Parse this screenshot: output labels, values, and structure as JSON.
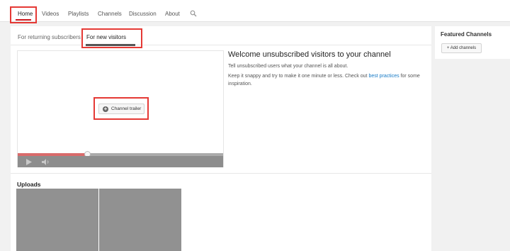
{
  "nav": {
    "tabs": [
      "Home",
      "Videos",
      "Playlists",
      "Channels",
      "Discussion",
      "About"
    ],
    "active_tab": "Home",
    "search_icon": "search-icon"
  },
  "subtabs": {
    "returning": "For returning subscribers",
    "new_visitors": "For new visitors",
    "active": "For new visitors"
  },
  "player": {
    "trailer_button": "Channel trailer",
    "trailer_icon": "plus-circle-icon",
    "progress_fraction": 0.34,
    "play_icon": "play-icon",
    "volume_icon": "volume-icon"
  },
  "welcome": {
    "heading": "Welcome unsubscribed visitors to your channel",
    "line1": "Tell unsubscribed users what your channel is all about.",
    "line2_pre": "Keep it snappy and try to make it one minute or less. Check out ",
    "line2_link": "best practices",
    "line2_post": " for some inspiration."
  },
  "uploads": {
    "title": "Uploads"
  },
  "featured": {
    "title": "Featured Channels",
    "add_button": "+ Add channels"
  },
  "colors": {
    "highlight_box": "#e53935",
    "active_underline": "#cc181e",
    "link": "#167ac6",
    "progress_fill": "#d96b6b"
  }
}
